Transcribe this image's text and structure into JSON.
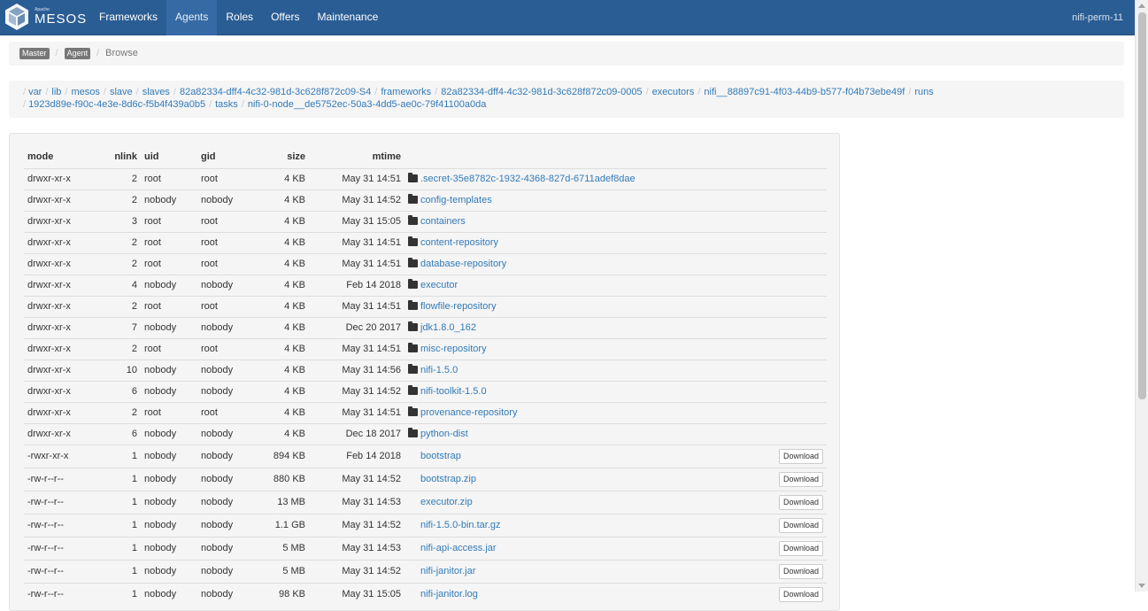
{
  "navbar": {
    "brand_small": "Apache",
    "brand": "MESOS",
    "items": [
      {
        "label": "Frameworks",
        "active": false
      },
      {
        "label": "Agents",
        "active": true
      },
      {
        "label": "Roles",
        "active": false
      },
      {
        "label": "Offers",
        "active": false
      },
      {
        "label": "Maintenance",
        "active": false
      }
    ],
    "cluster_name": "nifi-perm-11"
  },
  "breadcrumb": {
    "master": "Master",
    "agent": "Agent",
    "current": "Browse"
  },
  "path": [
    "var",
    "lib",
    "mesos",
    "slave",
    "slaves",
    "82a82334-dff4-4c32-981d-3c628f872c09-S4",
    "frameworks",
    "82a82334-dff4-4c32-981d-3c628f872c09-0005",
    "executors",
    "nifi__88897c91-4f03-44b9-b577-f04b73ebe49f",
    "runs",
    "1923d89e-f90c-4e3e-8d6c-f5b4f439a0b5",
    "tasks",
    "nifi-0-node__de5752ec-50a3-4dd5-ae0c-79f41100a0da"
  ],
  "table": {
    "headers": {
      "mode": "mode",
      "nlink": "nlink",
      "uid": "uid",
      "gid": "gid",
      "size": "size",
      "mtime": "mtime"
    },
    "download_label": "Download",
    "rows": [
      {
        "mode": "drwxr-xr-x",
        "nlink": "2",
        "uid": "root",
        "gid": "root",
        "size": "4 KB",
        "mtime": "May 31 14:51",
        "name": ".secret-35e8782c-1932-4368-827d-6711adef8dae",
        "dir": true
      },
      {
        "mode": "drwxr-xr-x",
        "nlink": "2",
        "uid": "nobody",
        "gid": "nobody",
        "size": "4 KB",
        "mtime": "May 31 14:52",
        "name": "config-templates",
        "dir": true
      },
      {
        "mode": "drwxr-xr-x",
        "nlink": "3",
        "uid": "root",
        "gid": "root",
        "size": "4 KB",
        "mtime": "May 31 15:05",
        "name": "containers",
        "dir": true
      },
      {
        "mode": "drwxr-xr-x",
        "nlink": "2",
        "uid": "root",
        "gid": "root",
        "size": "4 KB",
        "mtime": "May 31 14:51",
        "name": "content-repository",
        "dir": true
      },
      {
        "mode": "drwxr-xr-x",
        "nlink": "2",
        "uid": "root",
        "gid": "root",
        "size": "4 KB",
        "mtime": "May 31 14:51",
        "name": "database-repository",
        "dir": true
      },
      {
        "mode": "drwxr-xr-x",
        "nlink": "4",
        "uid": "nobody",
        "gid": "nobody",
        "size": "4 KB",
        "mtime": "Feb 14 2018",
        "name": "executor",
        "dir": true
      },
      {
        "mode": "drwxr-xr-x",
        "nlink": "2",
        "uid": "root",
        "gid": "root",
        "size": "4 KB",
        "mtime": "May 31 14:51",
        "name": "flowfile-repository",
        "dir": true
      },
      {
        "mode": "drwxr-xr-x",
        "nlink": "7",
        "uid": "nobody",
        "gid": "nobody",
        "size": "4 KB",
        "mtime": "Dec 20 2017",
        "name": "jdk1.8.0_162",
        "dir": true
      },
      {
        "mode": "drwxr-xr-x",
        "nlink": "2",
        "uid": "root",
        "gid": "root",
        "size": "4 KB",
        "mtime": "May 31 14:51",
        "name": "misc-repository",
        "dir": true
      },
      {
        "mode": "drwxr-xr-x",
        "nlink": "10",
        "uid": "nobody",
        "gid": "nobody",
        "size": "4 KB",
        "mtime": "May 31 14:56",
        "name": "nifi-1.5.0",
        "dir": true
      },
      {
        "mode": "drwxr-xr-x",
        "nlink": "6",
        "uid": "nobody",
        "gid": "nobody",
        "size": "4 KB",
        "mtime": "May 31 14:52",
        "name": "nifi-toolkit-1.5.0",
        "dir": true
      },
      {
        "mode": "drwxr-xr-x",
        "nlink": "2",
        "uid": "root",
        "gid": "root",
        "size": "4 KB",
        "mtime": "May 31 14:51",
        "name": "provenance-repository",
        "dir": true
      },
      {
        "mode": "drwxr-xr-x",
        "nlink": "6",
        "uid": "nobody",
        "gid": "nobody",
        "size": "4 KB",
        "mtime": "Dec 18 2017",
        "name": "python-dist",
        "dir": true
      },
      {
        "mode": "-rwxr-xr-x",
        "nlink": "1",
        "uid": "nobody",
        "gid": "nobody",
        "size": "894 KB",
        "mtime": "Feb 14 2018",
        "name": "bootstrap",
        "dir": false
      },
      {
        "mode": "-rw-r--r--",
        "nlink": "1",
        "uid": "nobody",
        "gid": "nobody",
        "size": "880 KB",
        "mtime": "May 31 14:52",
        "name": "bootstrap.zip",
        "dir": false
      },
      {
        "mode": "-rw-r--r--",
        "nlink": "1",
        "uid": "nobody",
        "gid": "nobody",
        "size": "13 MB",
        "mtime": "May 31 14:53",
        "name": "executor.zip",
        "dir": false
      },
      {
        "mode": "-rw-r--r--",
        "nlink": "1",
        "uid": "nobody",
        "gid": "nobody",
        "size": "1.1 GB",
        "mtime": "May 31 14:52",
        "name": "nifi-1.5.0-bin.tar.gz",
        "dir": false
      },
      {
        "mode": "-rw-r--r--",
        "nlink": "1",
        "uid": "nobody",
        "gid": "nobody",
        "size": "5 MB",
        "mtime": "May 31 14:53",
        "name": "nifi-api-access.jar",
        "dir": false
      },
      {
        "mode": "-rw-r--r--",
        "nlink": "1",
        "uid": "nobody",
        "gid": "nobody",
        "size": "5 MB",
        "mtime": "May 31 14:52",
        "name": "nifi-janitor.jar",
        "dir": false
      },
      {
        "mode": "-rw-r--r--",
        "nlink": "1",
        "uid": "nobody",
        "gid": "nobody",
        "size": "98 KB",
        "mtime": "May 31 15:05",
        "name": "nifi-janitor.log",
        "dir": false
      }
    ]
  }
}
